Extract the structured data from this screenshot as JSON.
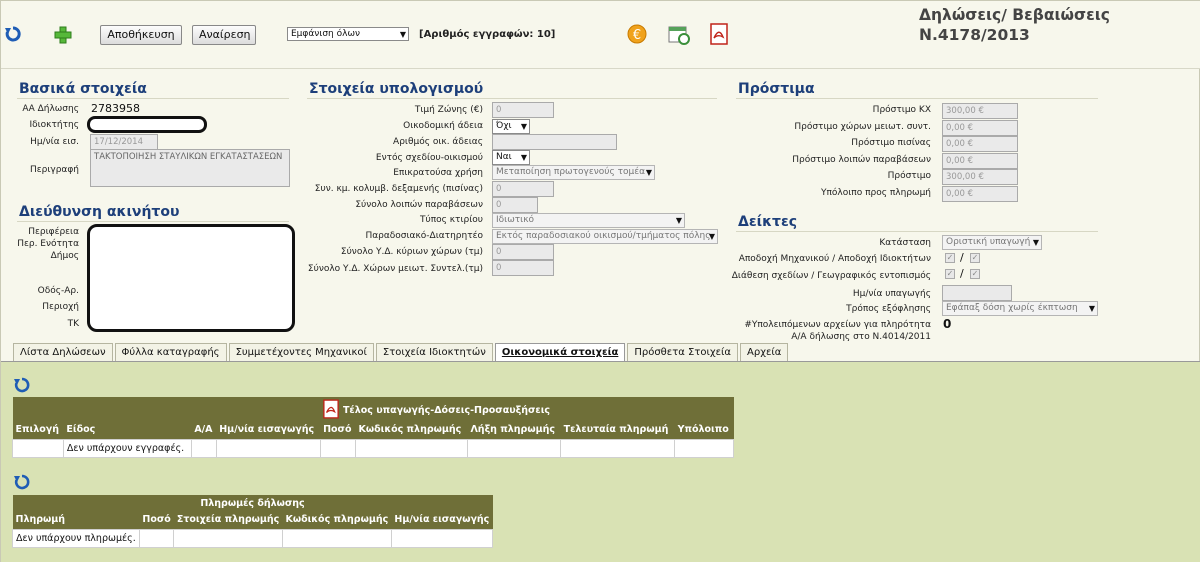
{
  "toolbar": {
    "save_label": "Αποθήκευση",
    "undo_label": "Αναίρεση",
    "filter_value": "Εμφάνιση όλων",
    "record_count": "[Αριθμός εγγραφών: 10]",
    "title": "Δηλώσεις/ Βεβαιώσεις Ν.4178/2013"
  },
  "basic": {
    "heading": "Βασικά στοιχεία",
    "aa_label": "ΑΑ Δήλωσης",
    "aa_value": "2783958",
    "owner_label": "Ιδιοκτήτης",
    "date_label": "Ημ/νία εισ.",
    "date_value": "17/12/2014",
    "desc_label": "Περιγραφή",
    "desc_value": "ΤΑΚΤΟΠΟΙΗΣΗ ΣΤΑΥΛΙΚΩΝ ΕΓΚΑΤΑΣΤΑΣΕΩΝ"
  },
  "address": {
    "heading": "Διεύθυνση ακινήτου",
    "region": "Περιφέρεια",
    "unit": "Περ. Ενότητα",
    "municipality": "Δήμος",
    "street": "Οδός-Αρ.",
    "area": "Περιοχή",
    "zip": "ΤΚ"
  },
  "calc": {
    "heading": "Στοιχεία υπολογισμού",
    "zone_label": "Τιμή Ζώνης (€)",
    "zone_value": "0",
    "permit_label": "Οικοδομική άδεια",
    "permit_value": "Όχι",
    "permit_no_label": "Αριθμός οικ. άδειας",
    "plan_label": "Εντός σχεδίου-οικισμού",
    "plan_value": "Ναι",
    "use_label": "Επικρατούσα χρήση",
    "use_value": "Μεταποίηση πρωτογενούς τομέα",
    "pool_label": "Συν. κμ. κολυμβ. δεξαμενής (πισίνας)",
    "pool_value": "0",
    "other_label": "Σύνολο λοιπών παραβάσεων",
    "other_value": "0",
    "type_label": "Τύπος κτιρίου",
    "type_value": "Ιδιωτικό",
    "coast_label": "Παραδοσιακό-Διατηρητέο",
    "coast_value": "Εκτός παραδοσιακού οικισμού/τμήματος πόλης",
    "main_label": "Σύνολο Υ.Δ. κύριων χώρων (τμ)",
    "main_value": "0",
    "aux_label": "Σύνολο Υ.Δ. Χώρων μειωτ. Συντελ.(τμ)",
    "aux_value": "0"
  },
  "fines": {
    "heading": "Πρόστιμα",
    "rows": [
      {
        "label": "Πρόστιμο ΚΧ",
        "value": "300,00 €"
      },
      {
        "label": "Πρόστιμο χώρων μειωτ. συντ.",
        "value": "0,00 €"
      },
      {
        "label": "Πρόστιμο πισίνας",
        "value": "0,00 €"
      },
      {
        "label": "Πρόστιμο λοιπών παραβάσεων",
        "value": "0,00 €"
      },
      {
        "label": "Πρόστιμο",
        "value": "300,00 €"
      },
      {
        "label": "Υπόλοιπο προς πληρωμή",
        "value": "0,00 €"
      }
    ]
  },
  "indicators": {
    "heading": "Δείκτες",
    "status_label": "Κατάσταση",
    "status_value": "Οριστική υπαγωγή",
    "accept_label": "Αποδοχή Μηχανικού / Αποδοχή Ιδιοκτήτων",
    "drawings_label": "Διάθεση σχεδίων / Γεωγραφικός εντοπισμός",
    "slash": "/",
    "date_label": "Ημ/νία υπαγωγής",
    "payment_label": "Τρόπος εξόφλησης",
    "payment_value": "Εφάπαξ δόση χωρίς έκπτωση",
    "files_label": "#Υπολειπόμενων αρχείων για πληρότητα",
    "files_value": "0",
    "aa4014_label": "Α/Α δήλωσης στο Ν.4014/2011"
  },
  "tabs": [
    "Λίστα Δηλώσεων",
    "Φύλλα καταγραφής",
    "Συμμετέχοντες Μηχανικοί",
    "Στοιχεία Ιδιοκτητών",
    "Οικονομικά στοιχεία",
    "Πρόσθετα Στοιχεία",
    "Αρχεία"
  ],
  "fees_table": {
    "title": "Τέλος υπαγωγής-Δόσεις-Προσαυξήσεις",
    "columns": [
      "Επιλογή",
      "Είδος",
      "Α/Α",
      "Ημ/νία εισαγωγής",
      "Ποσό",
      "Κωδικός πληρωμής",
      "Λήξη πληρωμής",
      "Τελευταία πληρωμή",
      "Υπόλοιπο"
    ],
    "empty": "Δεν υπάρχουν εγγραφές."
  },
  "payments_table": {
    "title": "Πληρωμές δήλωσης",
    "columns": [
      "Πληρωμή",
      "Ποσό",
      "Στοιχεία πληρωμής",
      "Κωδικός πληρωμής",
      "Ημ/νία εισαγωγής"
    ],
    "empty": "Δεν υπάρχουν πληρωμές."
  },
  "colors": {
    "heading": "#1d3f7a",
    "panel": "#d9e2b4",
    "table_header": "#6f6f38"
  }
}
